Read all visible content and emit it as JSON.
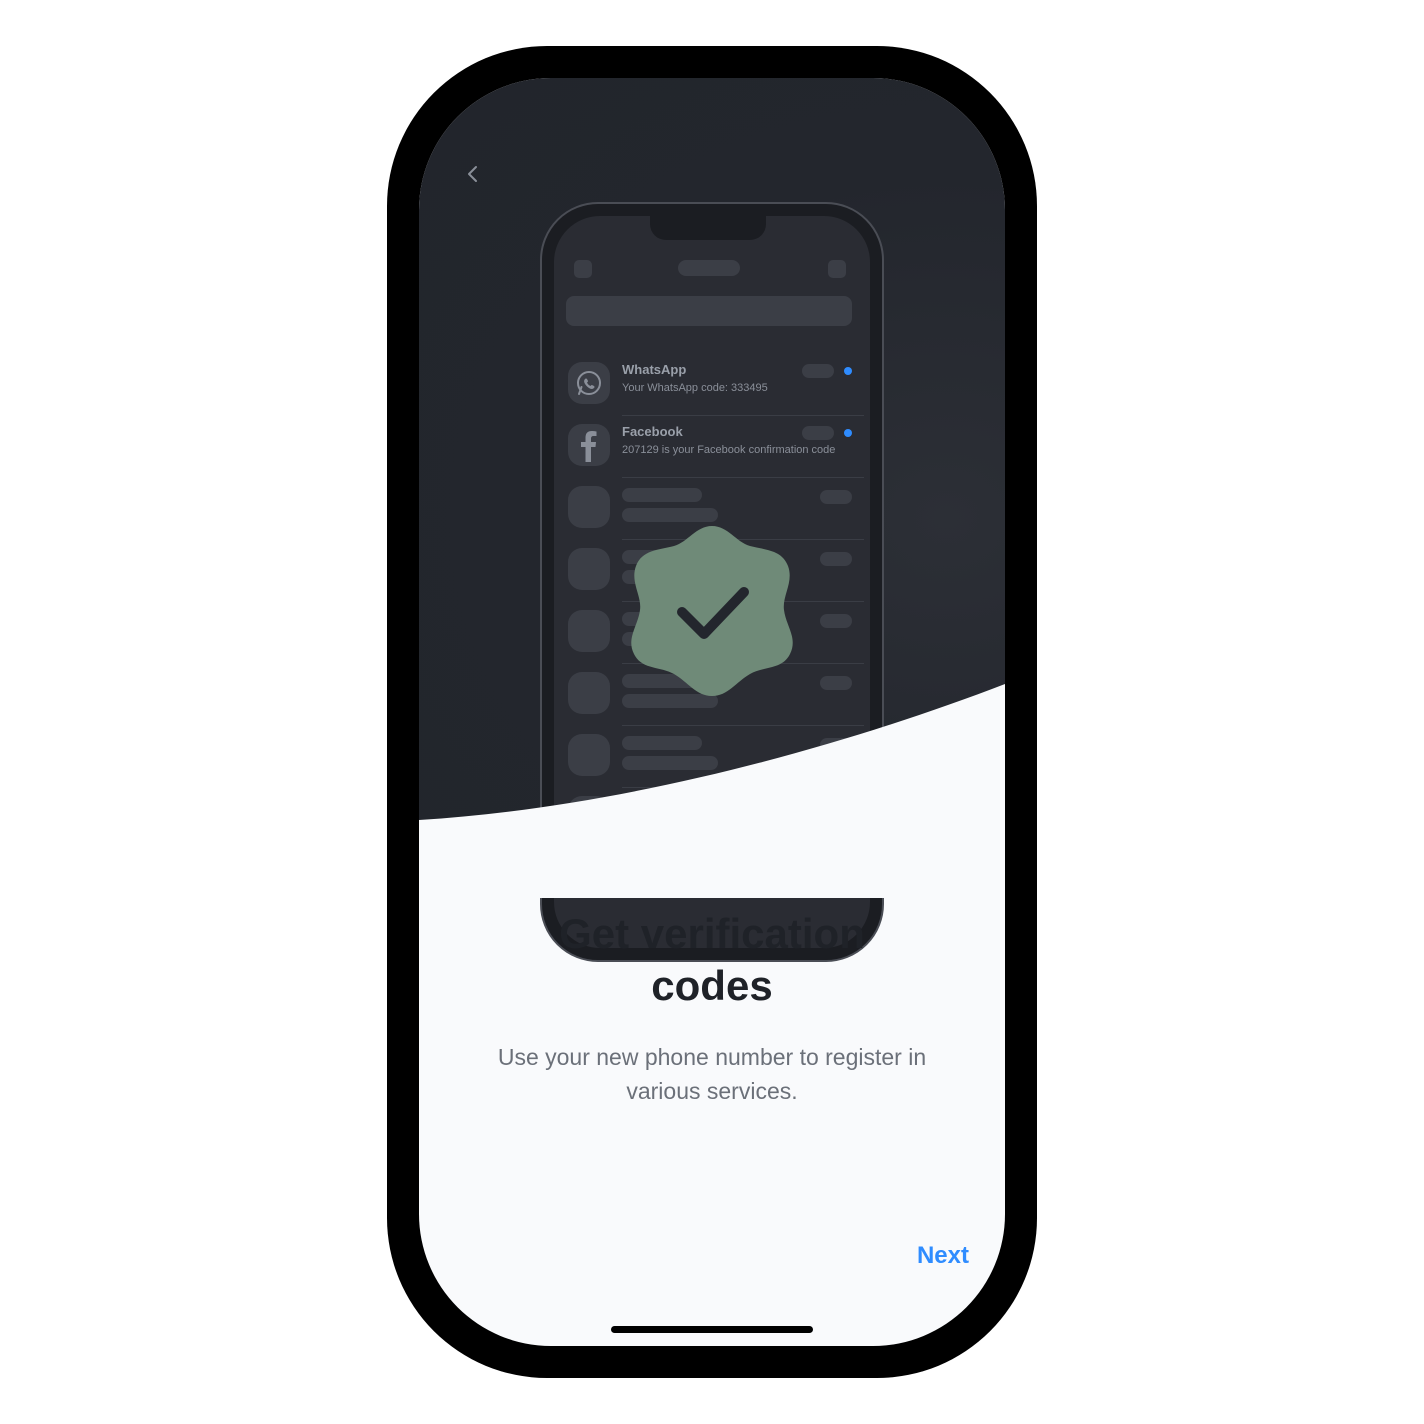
{
  "nav": {
    "back_icon": "chevron-left-icon"
  },
  "illustration": {
    "messages": [
      {
        "sender": "WhatsApp",
        "text": "Your WhatsApp code: 333495",
        "icon": "whatsapp-icon",
        "unread": true
      },
      {
        "sender": "Facebook",
        "text": "207129 is your Facebook confirmation code",
        "icon": "facebook-icon",
        "unread": true
      }
    ],
    "badge_icon": "verified-check-badge-icon"
  },
  "onboarding": {
    "title": "Get verification codes",
    "subtitle": "Use your new phone number to register in various services.",
    "next_label": "Next"
  },
  "colors": {
    "accent": "#2f8cff",
    "hero_background": "#23262d",
    "badge": "#6f8a78",
    "unread_dot": "#2f8cff",
    "title_text": "#1f2228",
    "subtitle_text": "#6b7079"
  }
}
